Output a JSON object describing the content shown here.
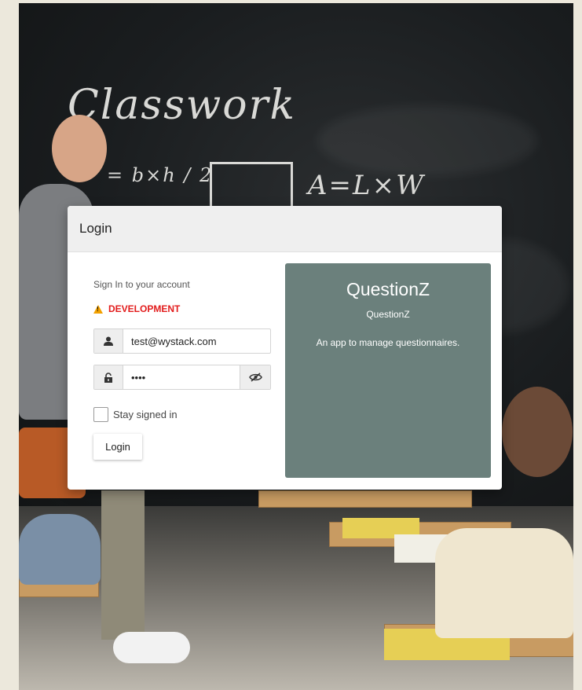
{
  "background": {
    "chalk_title": "Classwork",
    "chalk_formula_1": "= b×h / 2",
    "chalk_formula_2": "A=L×W"
  },
  "dialog": {
    "title": "Login",
    "signin_caption": "Sign In to your account",
    "environment_label": "DEVELOPMENT",
    "email_value": "test@wystack.com",
    "password_value": "••••",
    "remember_label": "Stay signed in",
    "login_button": "Login"
  },
  "info": {
    "title": "QuestionZ",
    "subtitle": "QuestionZ",
    "description": "An app to manage questionnaires."
  },
  "colors": {
    "panel": "#6b807c",
    "environment": "#e21c1c",
    "header": "#efefef"
  },
  "icons": [
    "user-icon",
    "lock-icon",
    "eye-slash-icon",
    "warning-icon"
  ]
}
